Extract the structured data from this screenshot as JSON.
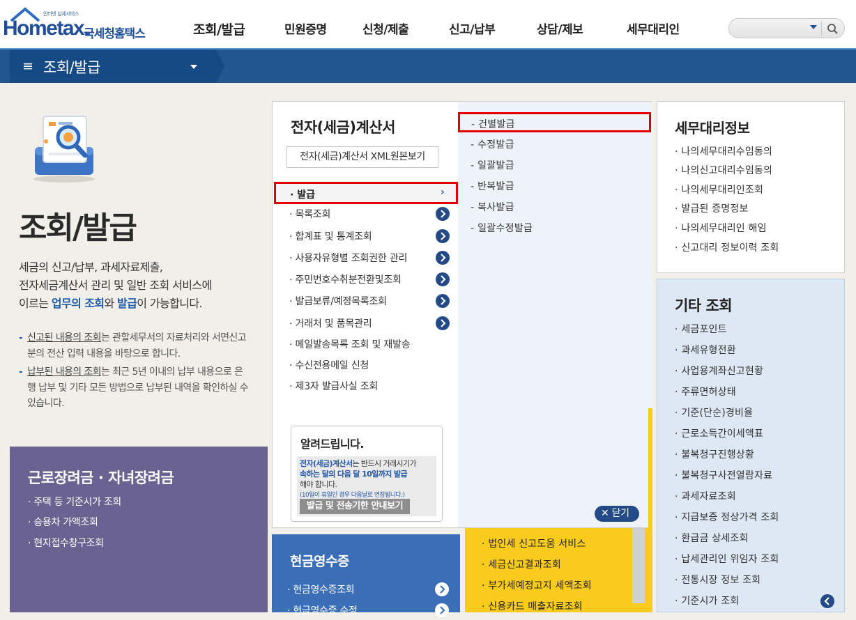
{
  "header": {
    "logo_small": "인터넷 납세서비스",
    "logo_main": "Hometax.",
    "logo_sub": "국세청홈택스",
    "nav": [
      "조회/발급",
      "민원증명",
      "신청/제출",
      "신고/납부",
      "상담/제보",
      "세무대리인"
    ]
  },
  "bar": {
    "menu_icon": "≡",
    "title": "조회/발급"
  },
  "intro": {
    "title": "조회/발급",
    "desc_1": "세금의 신고/납부, 과세자료제출,",
    "desc_2": "전자세금계산서 관리 및 일반 조회 서비스에",
    "desc_3_pre": "이르는 ",
    "desc_3_hl1": "업무의 조회",
    "desc_3_mid": "와 ",
    "desc_3_hl2": "발급",
    "desc_3_post": "이 가능합니다.",
    "bullets": [
      {
        "u": "신고된 내용의 조회",
        "rest": "는 관할세무서의 자료처리와 서면신고분의 전산 입력 내용을 바탕으로 합니다."
      },
      {
        "u": "납부된 내용의 조회",
        "rest": "는 최근 5년 이내의 납부 내용으로 은행 납부 및 기타 모든 방법으로 납부된 내역을 확인하실 수 있습니다."
      }
    ]
  },
  "purple_box": {
    "title": "근로장려금 · 자녀장려금",
    "items": [
      "주택 등 기준시가 조회",
      "승용차 가액조회",
      "현지접수창구조회"
    ]
  },
  "panel": {
    "title": "전자(세금)계산서",
    "xml_button": "전자(세금)계산서 XML원본보기",
    "selected_item": "발급",
    "items": [
      "목록조회",
      "합계표 및 통계조회",
      "사용자유형별 조회권한 관리",
      "주민번호수취분전환및조회",
      "발급보류/예정목록조회",
      "거래처 및 품목관리",
      "메일발송목록 조회 및 재발송",
      "수신전용메일 신청",
      "제3자 발급사실 조회"
    ],
    "sub_selected": "건별발급",
    "sub_items": [
      "수정발급",
      "일괄발급",
      "반복발급",
      "복사발급",
      "일괄수정발급"
    ],
    "notice": {
      "title": "알려드립니다.",
      "line_b1": "전자(세금)계산서",
      "line_1": "는 반드시 거래시기가",
      "line_b2": "속하는 달의 다음 달 10일까지 발급",
      "line_3": "해야 합니다.",
      "small": "(10일이 휴일인 경우 다음날로 연장됩니다.)",
      "button": "발급 및 전송기한 안내보기"
    },
    "close": "닫기"
  },
  "cash_box": {
    "title": "현금영수증",
    "items": [
      "현금영수증조회",
      "현금영수증 수정"
    ]
  },
  "yellow_box": {
    "items": [
      "법인세 신고도움 서비스",
      "세금신고결과조회",
      "부가세예정고지 세액조회",
      "신용카드 매출자료조회"
    ]
  },
  "tax_agent": {
    "title": "세무대리정보",
    "items": [
      "나의세무대리수임동의",
      "나의신고대리수임동의",
      "나의세무대리인조회",
      "발급된 증명정보",
      "나의세무대리인 해임",
      "신고대리 정보이력 조회"
    ]
  },
  "etc": {
    "title": "기타 조회",
    "items": [
      "세금포인트",
      "과세유형전환",
      "사업용계좌신고현황",
      "주류면허상태",
      "기준(단순)경비율",
      "근로소득간이세액표",
      "불복청구진행상황",
      "불복청구사전열람자료",
      "과세자료조회",
      "지급보증 정상가격 조회",
      "환급금 상세조회",
      "납세관리인 위임자 조회",
      "전통시장 정보 조회",
      "기준시가 조회"
    ]
  },
  "colors": {
    "brand_blue": "#1f4e9a",
    "bar_blue": "#21568f",
    "highlight_red": "#e00000",
    "purple": "#6a6290",
    "yellow": "#f8cb1c"
  }
}
